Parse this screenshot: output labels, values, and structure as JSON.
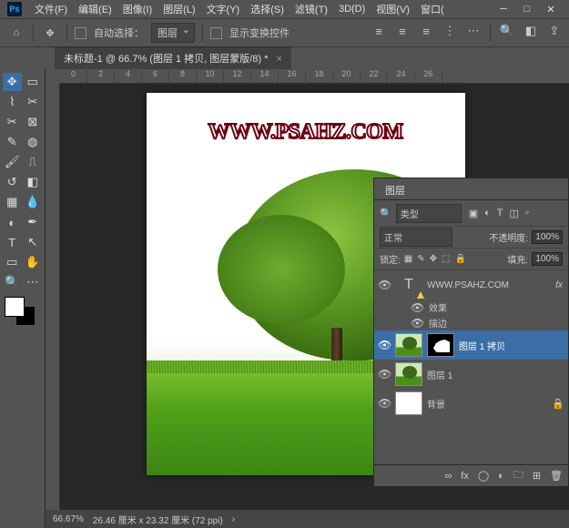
{
  "menubar": {
    "items": [
      "文件(F)",
      "编辑(E)",
      "图像(I)",
      "图层(L)",
      "文字(Y)",
      "选择(S)",
      "滤镜(T)",
      "3D(D)",
      "视图(V)",
      "窗口("
    ]
  },
  "optbar": {
    "auto_select": "自动选择：",
    "target": "图层",
    "show_transform": "显示变换控件"
  },
  "doctab": {
    "label": "未标题-1 @ 66.7% (图层 1 拷贝, 图层蒙版/8) *",
    "close": "×"
  },
  "ruler_ticks": [
    "0",
    "2",
    "4",
    "6",
    "8",
    "10",
    "12",
    "14",
    "16",
    "18",
    "20",
    "22",
    "24",
    "26"
  ],
  "canvas": {
    "watermark": "WWW.PSAHZ.COM"
  },
  "status": {
    "zoom": "66.67%",
    "dims": "26.46 厘米 x 23.32 厘米 (72 ppi)"
  },
  "panel": {
    "tab": "图层",
    "filter_label": "类型",
    "blend_mode": "正常",
    "opacity_label": "不透明度:",
    "opacity_value": "100%",
    "lock_label": "锁定:",
    "fill_label": "填充:",
    "fill_value": "100%",
    "layers": [
      {
        "name": "WWW.PSAHZ.COM",
        "type": "text",
        "fx": "fx"
      },
      {
        "name": "效果",
        "type": "fxhead"
      },
      {
        "name": "描边",
        "type": "fxitem"
      },
      {
        "name": "图层 1 拷贝",
        "type": "masked"
      },
      {
        "name": "图层 1",
        "type": "image"
      },
      {
        "name": "背景",
        "type": "bg"
      }
    ]
  }
}
